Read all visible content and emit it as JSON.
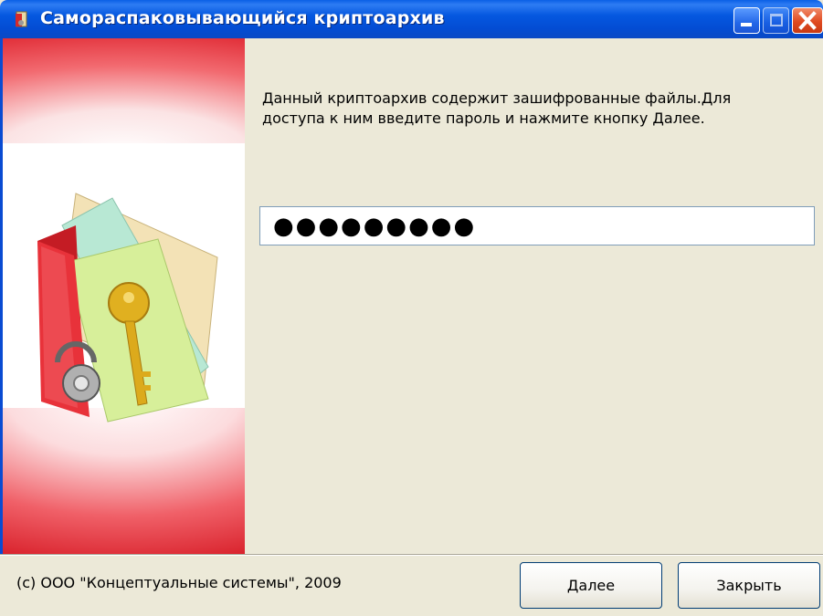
{
  "window": {
    "title": "Самораспаковывающийся криптоархив"
  },
  "main": {
    "instruction_line1": "Данный криптоархив содержит зашифрованные файлы.Для",
    "instruction_line2": "доступа к ним введите пароль и нажмите кнопку Далее.",
    "password_mask": "●●●●●●●●●"
  },
  "footer": {
    "copyright": "(c) ООО \"Концептуальные системы\", 2009",
    "next_label": "Далее",
    "close_label": "Закрыть"
  },
  "icons": {
    "app": "archive-icon",
    "minimize": "minimize-icon",
    "maximize": "maximize-icon",
    "close": "close-icon",
    "illustration": "encrypted-archive-illustration"
  },
  "colors": {
    "titlebar": "#0558E0",
    "side_panel": "#E02A34",
    "dialog_bg": "#ECE9D8",
    "close_button": "#E04A20"
  }
}
